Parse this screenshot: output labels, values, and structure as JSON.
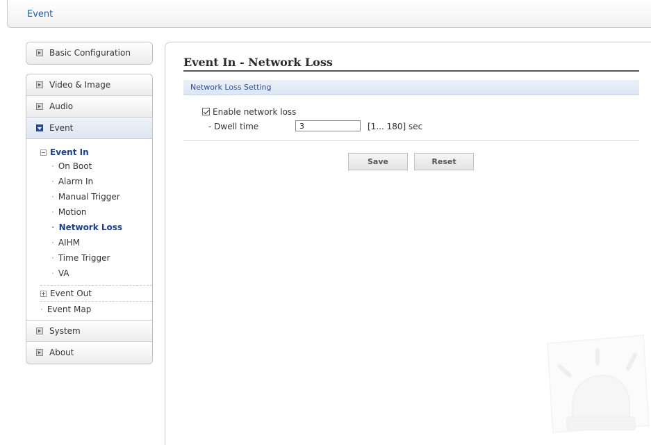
{
  "header": {
    "title": "Event"
  },
  "sidebar": {
    "top_item": "Basic Configuration",
    "items": [
      "Video & Image",
      "Audio",
      "Event"
    ],
    "event_in": {
      "label": "Event In",
      "children": [
        "On Boot",
        "Alarm In",
        "Manual Trigger",
        "Motion",
        "Network Loss",
        "AIHM",
        "Time Trigger",
        "VA"
      ]
    },
    "event_out": "Event Out",
    "event_map": "Event Map",
    "bottom_items": [
      "System",
      "About"
    ],
    "bullet": "·"
  },
  "main": {
    "title": "Event In - Network Loss",
    "section": "Network Loss Setting",
    "enable_label": "Enable network loss",
    "enable_checked": true,
    "dwell_label": "- Dwell time",
    "dwell_value": "3",
    "dwell_range": "[1... 180] sec",
    "save_label": "Save",
    "reset_label": "Reset"
  },
  "colors": {
    "accent": "#1b3f8f",
    "section_bg": "#e4ebf6",
    "active_nav": "#e5eaf4"
  },
  "icons": [
    "expand-box-icon",
    "collapse-box-icon",
    "tree-minus-icon",
    "tree-plus-icon",
    "checkbox-icon",
    "alarm-light-icon"
  ]
}
